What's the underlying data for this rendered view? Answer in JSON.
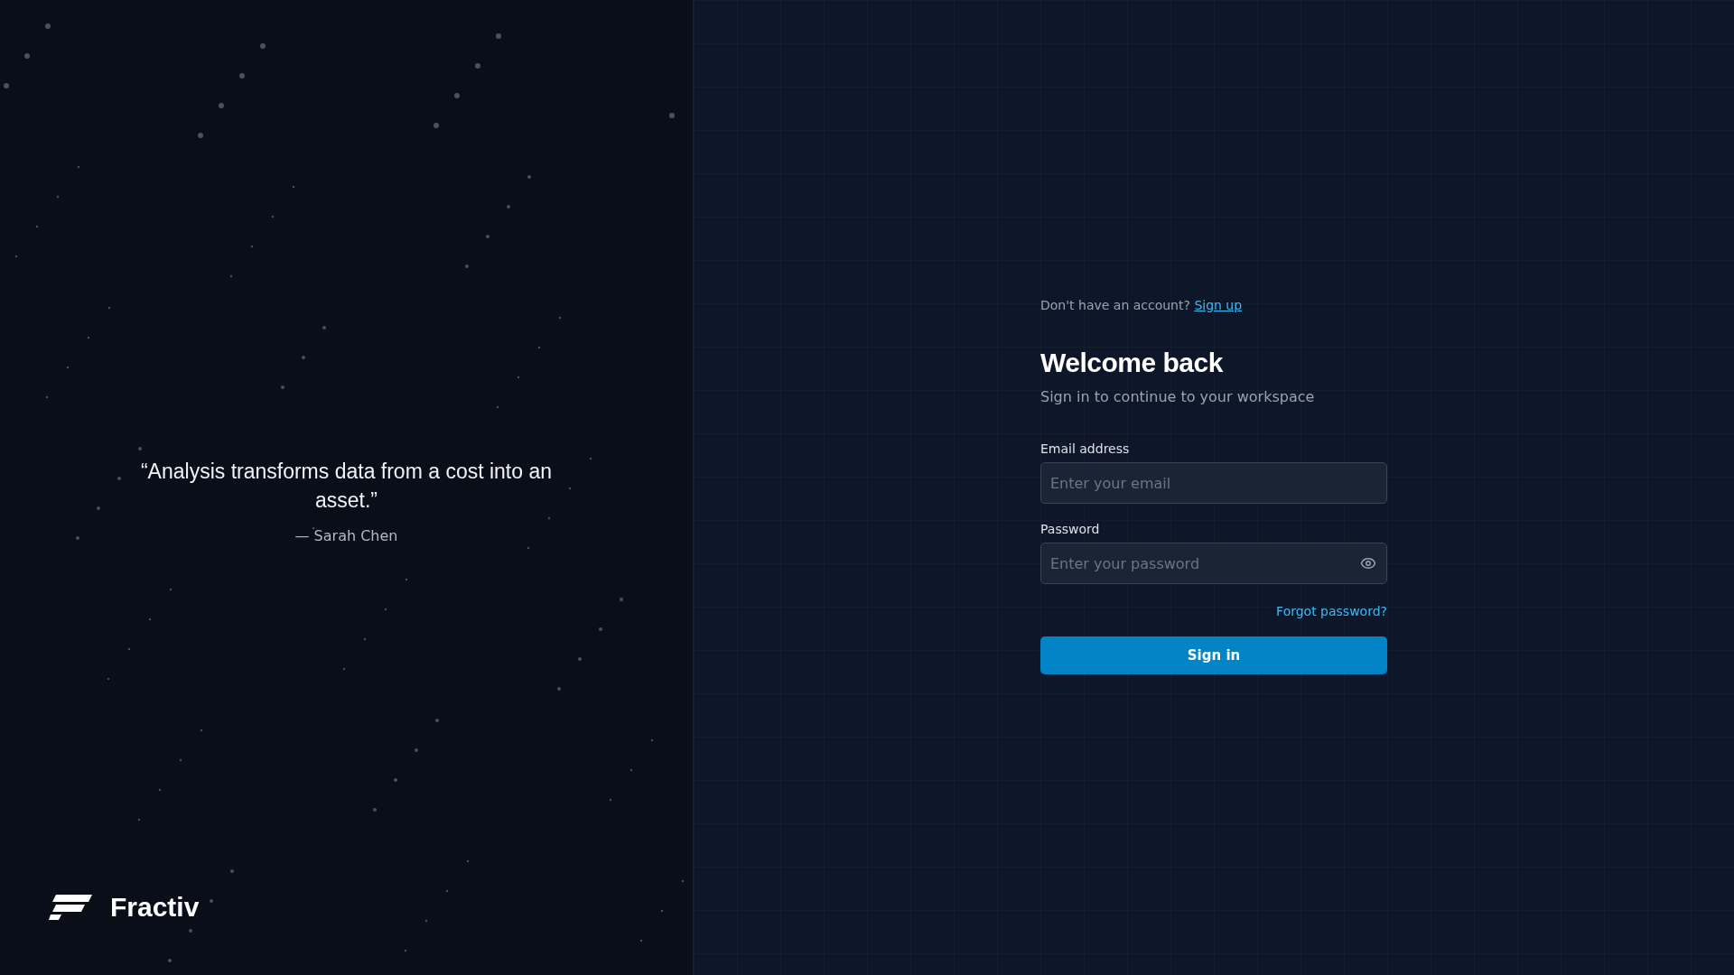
{
  "quote": {
    "text": "“Analysis transforms data from a cost into an asset.”",
    "author": "— Sarah Chen"
  },
  "brand": {
    "name": "Fractiv"
  },
  "signup_prompt": {
    "text": "Don't have an account?",
    "link": "Sign up"
  },
  "heading": "Welcome back",
  "subtitle": "Sign in to continue to your workspace",
  "fields": [
    {
      "kind": "email",
      "label": "Email address",
      "placeholder": "Enter your email"
    },
    {
      "kind": "password",
      "label": "Password",
      "placeholder": "Enter your password"
    }
  ],
  "forgot_link": "Forgot password?",
  "submit": "Sign in"
}
